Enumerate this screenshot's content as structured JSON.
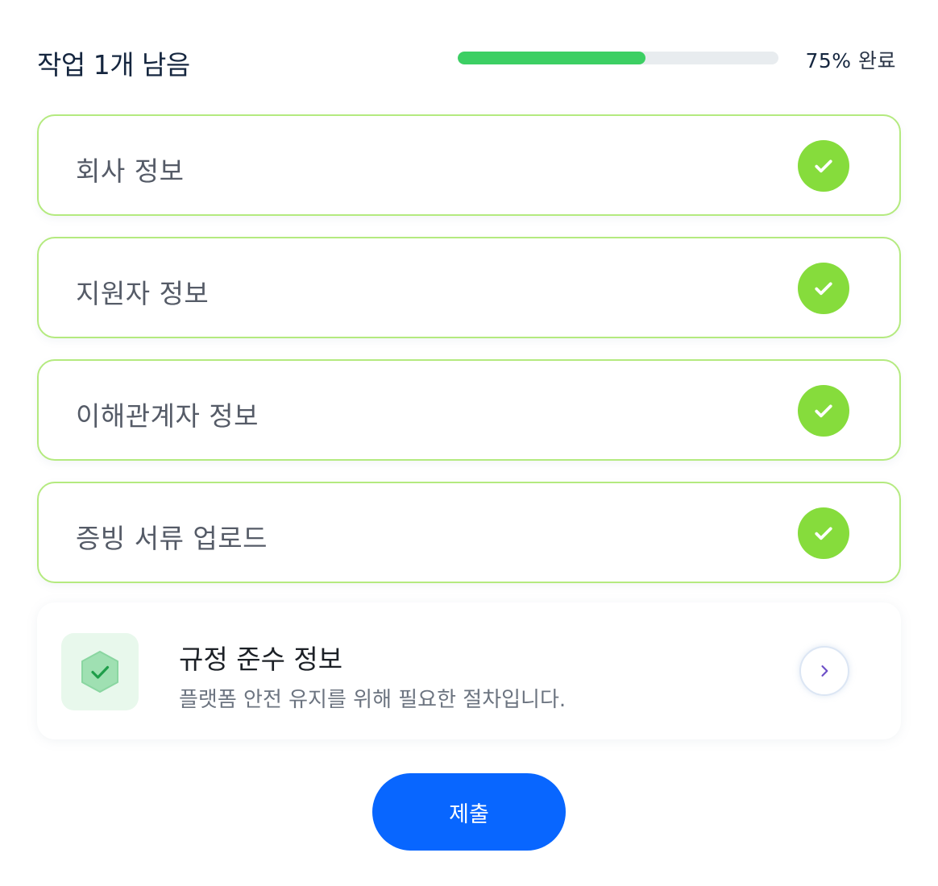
{
  "header": {
    "title": "작업 1개 남음",
    "progress_percent": 75,
    "progress_pct_text": "75%",
    "progress_suffix": " 완료"
  },
  "tasks": [
    {
      "label": "회사 정보",
      "status": "complete"
    },
    {
      "label": "지원자 정보",
      "status": "complete"
    },
    {
      "label": "이해관계자 정보",
      "status": "complete"
    },
    {
      "label": "증빙 서류 업로드",
      "status": "complete"
    }
  ],
  "compliance": {
    "title": "규정 준수 정보",
    "description": "플랫폼 안전 유지를 위해 필요한 절차입니다."
  },
  "submit": {
    "label": "제출"
  },
  "colors": {
    "accent": "#0866ff",
    "progress": "#3ccf63",
    "check": "#86dc3c",
    "task_border": "#b4ea7f"
  },
  "icons": {
    "task_status": "check-circle-icon",
    "compliance": "shield-check-icon",
    "open": "chevron-right-icon"
  }
}
